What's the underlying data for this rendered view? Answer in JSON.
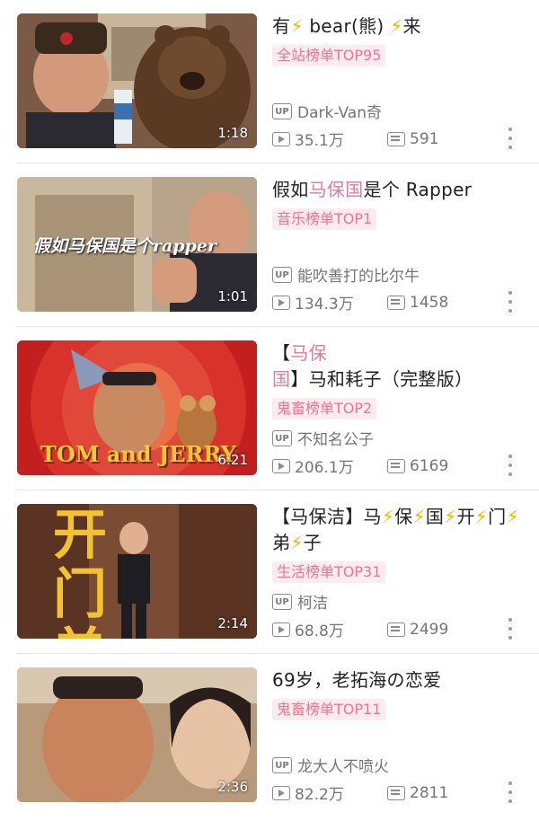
{
  "videos": [
    {
      "title_parts": [
        {
          "text": "有",
          "style": "normal"
        },
        {
          "text": "⚡",
          "style": "bolt"
        },
        {
          "text": " bear(熊) ",
          "style": "normal"
        },
        {
          "text": "⚡",
          "style": "bolt"
        },
        {
          "text": "来",
          "style": "normal"
        }
      ],
      "badge": "全站榜单TOP95",
      "uploader": "Dark-Van奇",
      "views": "35.1万",
      "danmaku": "591",
      "duration": "1:18",
      "thumb_caption": ""
    },
    {
      "title_parts": [
        {
          "text": "假如",
          "style": "normal"
        },
        {
          "text": "马保国",
          "style": "hl"
        },
        {
          "text": "是个 Rapper",
          "style": "normal"
        }
      ],
      "badge": "音乐榜单TOP1",
      "uploader": "能吹善打的比尔牛",
      "views": "134.3万",
      "danmaku": "1458",
      "duration": "1:01",
      "thumb_caption": "假如马保国是个rapper"
    },
    {
      "title_parts": [
        {
          "text": "【",
          "style": "normal"
        },
        {
          "text": "马保国",
          "style": "hl"
        },
        {
          "text": "】马和耗子（完整版）",
          "style": "normal"
        }
      ],
      "badge": "鬼畜榜单TOP2",
      "uploader": "不知名公子",
      "views": "206.1万",
      "danmaku": "6169",
      "duration": "6:21",
      "thumb_caption": "TOM and JERRY"
    },
    {
      "title_parts": [
        {
          "text": "【马保洁】马",
          "style": "normal"
        },
        {
          "text": "⚡",
          "style": "bolt"
        },
        {
          "text": "保",
          "style": "normal"
        },
        {
          "text": "⚡",
          "style": "bolt"
        },
        {
          "text": "国",
          "style": "normal"
        },
        {
          "text": "⚡",
          "style": "bolt"
        },
        {
          "text": "开",
          "style": "normal"
        },
        {
          "text": "⚡",
          "style": "bolt"
        },
        {
          "text": "门",
          "style": "normal"
        },
        {
          "text": "⚡",
          "style": "bolt"
        },
        {
          "text": "弟",
          "style": "normal"
        },
        {
          "text": "⚡",
          "style": "bolt"
        },
        {
          "text": "子",
          "style": "normal"
        }
      ],
      "badge": "生活榜单TOP31",
      "uploader": "柯洁",
      "views": "68.8万",
      "danmaku": "2499",
      "duration": "2:14",
      "thumb_caption": "开门弟子"
    },
    {
      "title_parts": [
        {
          "text": "69岁，老拓海の恋爱",
          "style": "normal"
        }
      ],
      "badge": "鬼畜榜单TOP11",
      "uploader": "龙大人不喷火",
      "views": "82.2万",
      "danmaku": "2811",
      "duration": "2:36",
      "thumb_caption": ""
    }
  ],
  "icons": {
    "uploader": "up-icon",
    "views": "play-icon",
    "danmaku": "danmaku-icon",
    "more": "more-vertical-icon"
  },
  "colors": {
    "accent_pink": "#f0748f",
    "badge_bg": "#fcebef",
    "highlight": "#e07aa0",
    "bolt": "#f5b400",
    "meta_gray": "#757575"
  }
}
